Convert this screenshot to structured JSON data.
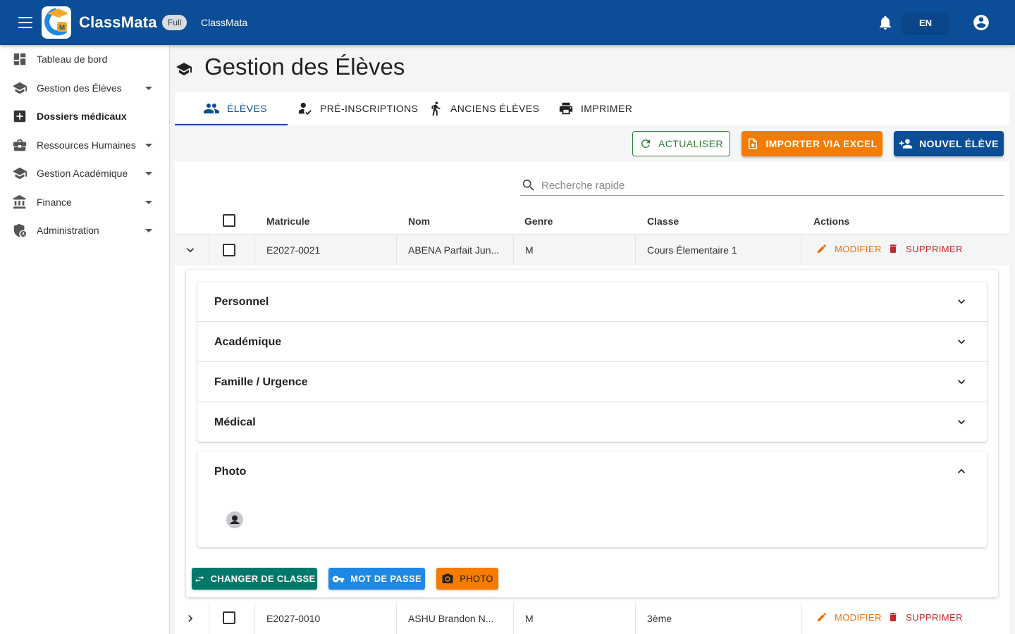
{
  "header": {
    "brand": "ClassMata",
    "plan_badge": "Full",
    "school_name": "ClassMata",
    "language": "EN"
  },
  "sidebar": {
    "items": [
      {
        "label": "Tableau de bord",
        "icon": "dashboard-icon"
      },
      {
        "label": "Gestion des Élèves",
        "icon": "school-icon"
      },
      {
        "label": "Dossiers médicaux",
        "icon": "medical-icon"
      },
      {
        "label": "Ressources Humaines",
        "icon": "briefcase-icon"
      },
      {
        "label": "Gestion Académique",
        "icon": "school-icon"
      },
      {
        "label": "Finance",
        "icon": "bank-icon"
      },
      {
        "label": "Administration",
        "icon": "admin-shield-icon"
      }
    ]
  },
  "page": {
    "title": "Gestion des Élèves"
  },
  "tabs": [
    {
      "label": "ÉLÈVES"
    },
    {
      "label": "PRÉ-INSCRIPTIONS"
    },
    {
      "label": "ANCIENS ÉLÈVES"
    },
    {
      "label": "IMPRIMER"
    }
  ],
  "toolbar": {
    "refresh": "ACTUALISER",
    "import": "IMPORTER VIA EXCEL",
    "new": "NOUVEL ÉLÈVE"
  },
  "search": {
    "placeholder": "Recherche rapide"
  },
  "table": {
    "columns": [
      "Matricule",
      "Nom",
      "Genre",
      "Classe",
      "Actions"
    ],
    "edit_label": "MODIFIER",
    "delete_label": "SUPPRIMER",
    "rows": [
      {
        "matricule": "E2027-0021",
        "nom": "ABENA Parfait Jun...",
        "genre": "M",
        "classe": "Cours Élementaire 1"
      },
      {
        "matricule": "E2027-0010",
        "nom": "ASHU Brandon N...",
        "genre": "M",
        "classe": "3ème"
      }
    ]
  },
  "detail": {
    "sections": [
      "Personnel",
      "Académique",
      "Famille / Urgence",
      "Médical"
    ],
    "photo_section": "Photo",
    "buttons": {
      "change_class": "CHANGER DE CLASSE",
      "password": "MOT DE PASSE",
      "photo": "PHOTO"
    }
  }
}
